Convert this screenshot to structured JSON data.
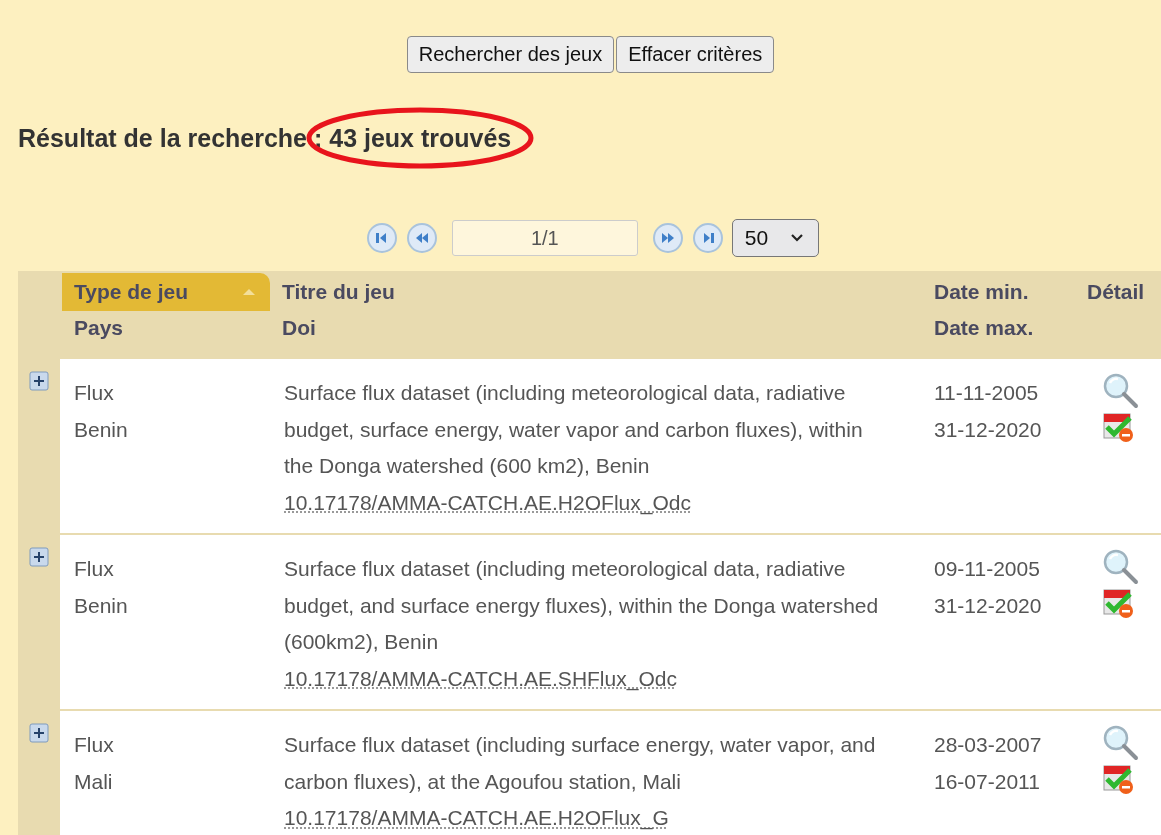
{
  "buttons": [
    "Rechercher des jeux",
    "Effacer critères"
  ],
  "result_heading": "Résultat de la recherche : 43 jeux trouvés",
  "pager": {
    "page": "1/1",
    "page_size": "50"
  },
  "columns": [
    {
      "line1": "Type de jeu",
      "line2": "Pays",
      "sorted": true
    },
    {
      "line1": "Titre du jeu",
      "line2": "Doi",
      "sorted": false
    },
    {
      "line1": "Date min.",
      "line2": "Date max.",
      "sorted": false
    },
    {
      "line1": "Détail",
      "sorted": false
    }
  ],
  "rows": [
    {
      "type": "Flux",
      "country": "Benin",
      "title": "Surface flux dataset (including meteorological data, radiative budget, surface energy, water vapor and carbon fluxes), within the Donga watershed (600 km2), Benin",
      "doi": "10.17178/AMMA-CATCH.AE.H2OFlux_Odc",
      "date_min": "11-11-2005",
      "date_max": "31-12-2020",
      "expanded": false
    },
    {
      "type": "Flux",
      "country": "Benin",
      "title": "Surface flux dataset (including meteorological data, radiative budget, and surface energy fluxes), within the Donga watershed (600km2), Benin",
      "doi": "10.17178/AMMA-CATCH.AE.SHFlux_Odc",
      "date_min": "09-11-2005",
      "date_max": "31-12-2020",
      "expanded": false
    },
    {
      "type": "Flux",
      "country": "Mali",
      "title": "Surface flux dataset (including surface energy, water vapor, and carbon fluxes), at the Agoufou station, Mali",
      "doi": "10.17178/AMMA-CATCH.AE.H2OFlux_G",
      "date_min": "28-03-2007",
      "date_max": "16-07-2011",
      "expanded": false
    }
  ]
}
